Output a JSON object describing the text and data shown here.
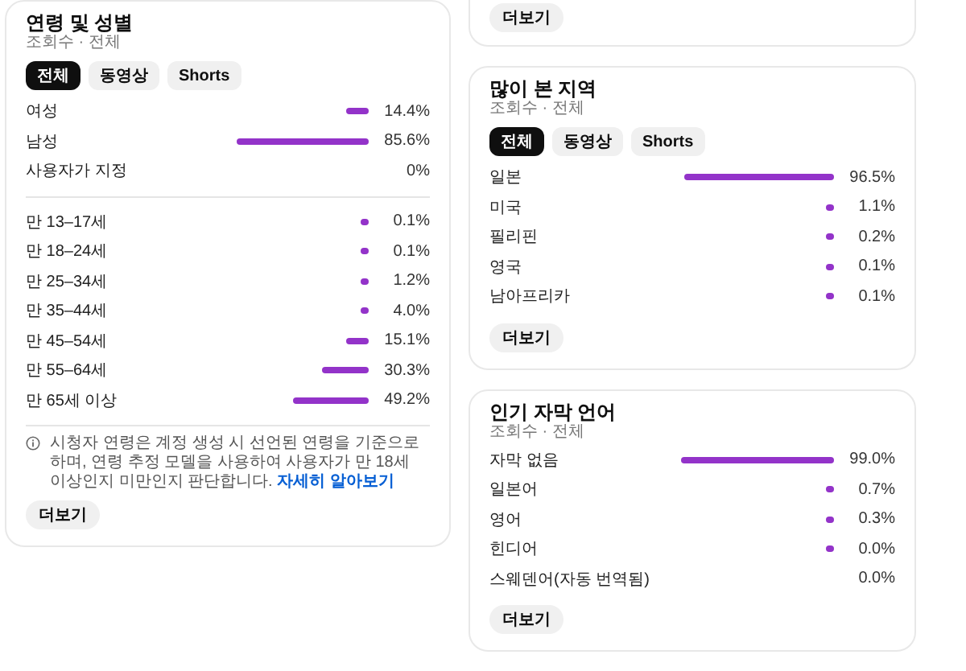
{
  "columns": [
    [
      {
        "title": "연령 및 성별",
        "subtitle": "조회수 · 전체",
        "tabs": [
          {
            "label": "전체",
            "selected": true
          },
          {
            "label": "동영상",
            "selected": false
          },
          {
            "label": "Shorts",
            "selected": false
          }
        ],
        "groups": [
          [
            {
              "label": "여성",
              "value": "14.4%",
              "bar": true
            },
            {
              "label": "남성",
              "value": "85.6%",
              "bar": true
            },
            {
              "label": "사용자가 지정",
              "value": "0%",
              "bar": false
            }
          ],
          [
            {
              "label": "만 13–17세",
              "value": "0.1%",
              "bar": true
            },
            {
              "label": "만 18–24세",
              "value": "0.1%",
              "bar": true
            },
            {
              "label": "만 25–34세",
              "value": "1.2%",
              "bar": true
            },
            {
              "label": "만 35–44세",
              "value": "4.0%",
              "bar": true
            },
            {
              "label": "만 45–54세",
              "value": "15.1%",
              "bar": true
            },
            {
              "label": "만 55–64세",
              "value": "30.3%",
              "bar": true
            },
            {
              "label": "만 65세 이상",
              "value": "49.2%",
              "bar": true
            }
          ]
        ],
        "note": {
          "text": "시청자 연령은 계정 생성 시 선언된 연령을 기준으로 하며, 연령 추정 모델을 사용하여 사용자가 만 18세 이상인지 미만인지 판단합니다.",
          "link": "자세히 알아보기"
        },
        "more_button": "더보기"
      }
    ],
    [
      {
        "more_button": "더보기"
      },
      {
        "title": "많이 본 지역",
        "subtitle": "조회수 · 전체",
        "tabs": [
          {
            "label": "전체",
            "selected": true
          },
          {
            "label": "동영상",
            "selected": false
          },
          {
            "label": "Shorts",
            "selected": false
          }
        ],
        "groups": [
          [
            {
              "label": "일본",
              "value": "96.5%",
              "bar": true
            },
            {
              "label": "미국",
              "value": "1.1%",
              "bar": true
            },
            {
              "label": "필리핀",
              "value": "0.2%",
              "bar": true
            },
            {
              "label": "영국",
              "value": "0.1%",
              "bar": true
            },
            {
              "label": "남아프리카",
              "value": "0.1%",
              "bar": true
            }
          ]
        ],
        "more_button": "더보기"
      },
      {
        "title": "인기 자막 언어",
        "subtitle": "조회수 · 전체",
        "groups": [
          [
            {
              "label": "자막 없음",
              "value": "99.0%",
              "bar": true
            },
            {
              "label": "일본어",
              "value": "0.7%",
              "bar": true
            },
            {
              "label": "영어",
              "value": "0.3%",
              "bar": true
            },
            {
              "label": "힌디어",
              "value": "0.0%",
              "bar": true
            },
            {
              "label": "스웨덴어(자동 번역됨)",
              "value": "0.0%",
              "bar": false
            }
          ]
        ],
        "more_button": "더보기"
      }
    ]
  ]
}
